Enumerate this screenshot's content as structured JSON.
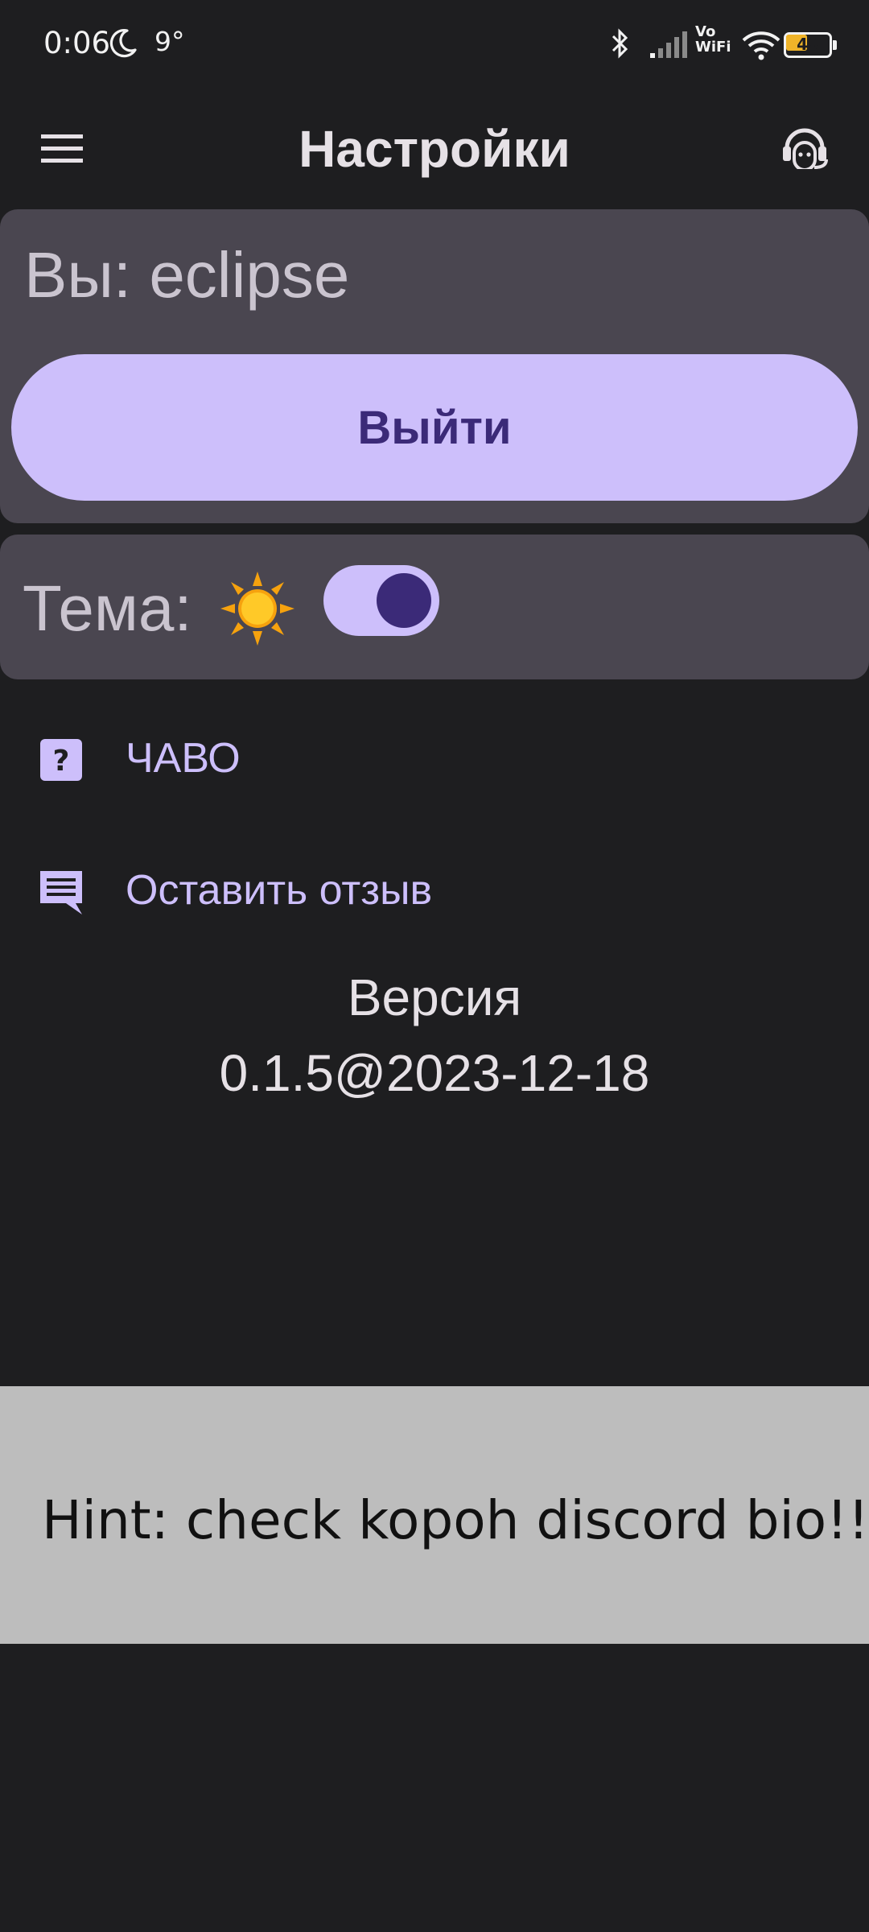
{
  "status_bar": {
    "time": "0:06",
    "temperature": "9°",
    "network_label": "Vo\nWiFi",
    "battery_level": "49",
    "icons": [
      "moon-icon",
      "bluetooth-icon",
      "signal-icon",
      "wifi-icon",
      "battery-icon"
    ]
  },
  "app_bar": {
    "title": "Настройки",
    "left_icon": "menu-icon",
    "right_icon": "support-headset-icon"
  },
  "account": {
    "user_label": "Вы: eclipse",
    "logout_label": "Выйти"
  },
  "theme": {
    "label": "Тема:",
    "icon": "sun-icon",
    "toggle_on": true
  },
  "menu": {
    "faq_label": "ЧАВО",
    "feedback_label": "Оставить отзыв"
  },
  "version": {
    "label": "Версия",
    "value": "0.1.5@2023-12-18"
  },
  "hint": {
    "text": "Hint: check koроh discord bio!!"
  },
  "colors": {
    "background": "#1e1e20",
    "card": "#4a4650",
    "accent": "#cdbffb",
    "accent_dark": "#3b2a78",
    "hint_background": "#bdbdbd"
  }
}
